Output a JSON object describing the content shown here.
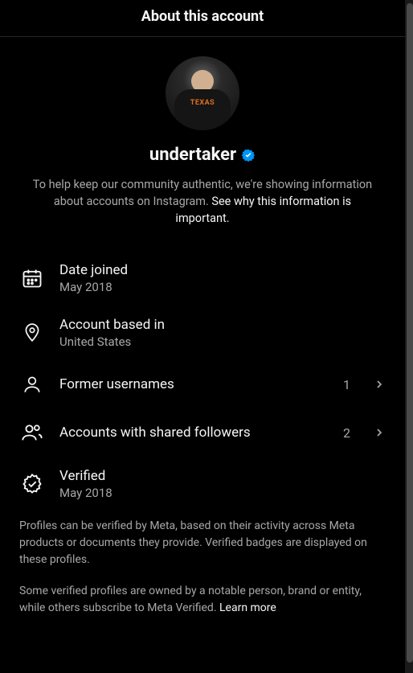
{
  "header": {
    "title": "About this account"
  },
  "profile": {
    "username": "undertaker",
    "intro_prefix": "To help keep our community authentic, we're showing information about accounts on Instagram. ",
    "intro_link": "See why this information is important."
  },
  "info": {
    "date_joined": {
      "label": "Date joined",
      "value": "May 2018"
    },
    "account_based": {
      "label": "Account based in",
      "value": "United States"
    },
    "former_usernames": {
      "label": "Former usernames",
      "count": "1"
    },
    "shared_followers": {
      "label": "Accounts with shared followers",
      "count": "2"
    },
    "verified": {
      "label": "Verified",
      "value": "May 2018"
    }
  },
  "footer": {
    "para1": "Profiles can be verified by Meta, based on their activity across Meta products or documents they provide. Verified badges are displayed on these profiles.",
    "para2_prefix": "Some verified profiles are owned by a notable person, brand or entity, while others subscribe to Meta Verified. ",
    "para2_link": "Learn more"
  }
}
